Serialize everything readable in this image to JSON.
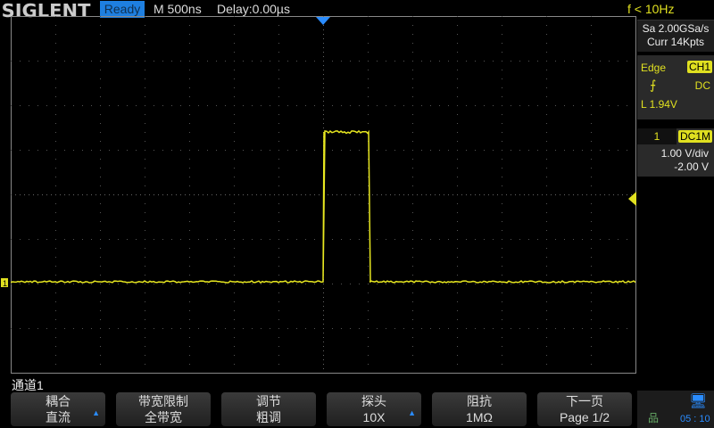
{
  "header": {
    "logo": "SIGLENT",
    "status": "Ready",
    "timebase": "M 500ns",
    "delay": "Delay:0.00µs",
    "frequency": "f < 10Hz"
  },
  "acquisition": {
    "sample_rate": "Sa 2.00GSa/s",
    "memory": "Curr 14Kpts"
  },
  "trigger": {
    "type": "Edge",
    "source": "CH1",
    "coupling": "DC",
    "slope_icon": "rising-edge-icon",
    "level": "L  1.94V"
  },
  "channel": {
    "number": "1",
    "coupling": "DC1M",
    "scale": "1.00 V/div",
    "offset": "-2.00 V"
  },
  "menu_title": "通道1",
  "softkeys": [
    {
      "top": "耦合",
      "bottom": "直流",
      "arrow": true
    },
    {
      "top": "带宽限制",
      "bottom": "全带宽",
      "arrow": false
    },
    {
      "top": "调节",
      "bottom": "粗调",
      "arrow": false
    },
    {
      "top": "探头",
      "bottom": "10X",
      "arrow": true
    },
    {
      "top": "阻抗",
      "bottom": "1MΩ",
      "arrow": false
    },
    {
      "top": "下一页",
      "bottom": "Page 1/2",
      "arrow": false
    }
  ],
  "status_bar": {
    "time": "05 : 10"
  },
  "colors": {
    "trace": "#e8e820",
    "accent": "#1e7fe0",
    "grid": "#555555"
  }
}
